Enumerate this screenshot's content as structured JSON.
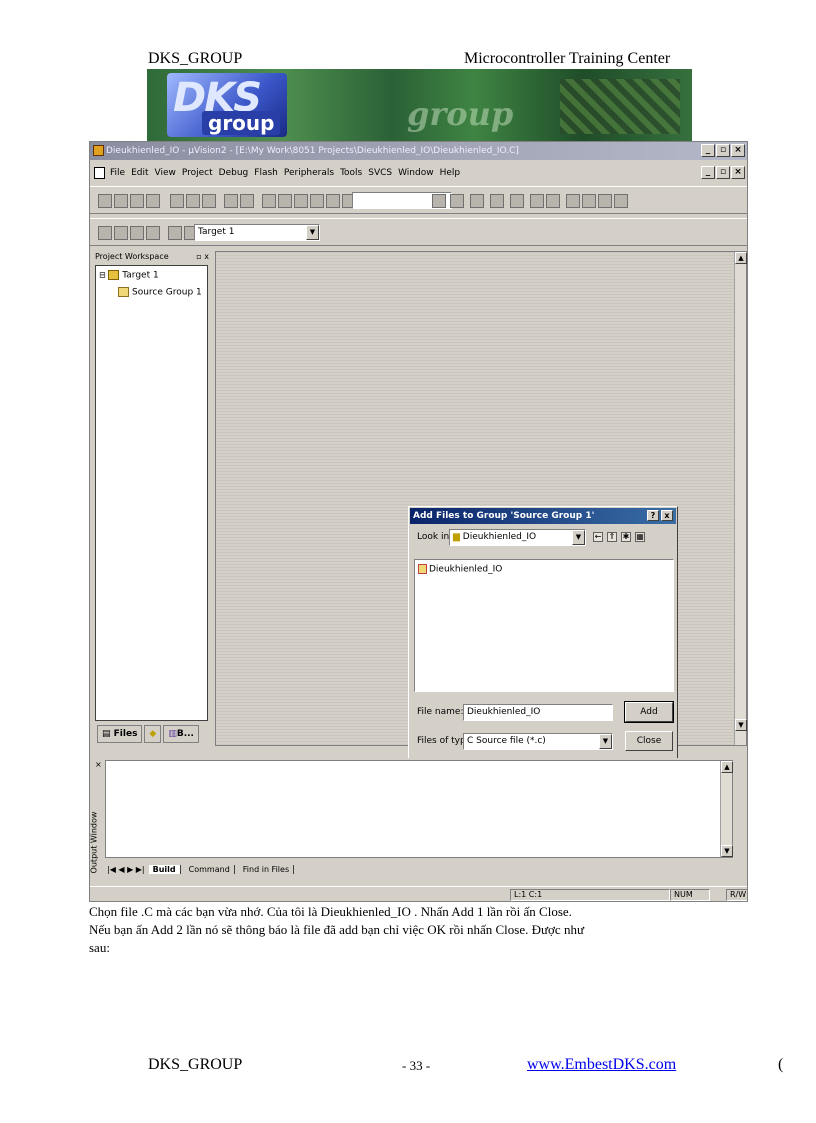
{
  "header": {
    "left": "DKS_GROUP",
    "right": "Microcontroller Training Center"
  },
  "banner": {
    "logo_text": "DKS",
    "logo_sub": "group",
    "watermark": "group"
  },
  "app": {
    "title": "Dieukhienled_IO - µVision2 - [E:\\My Work\\8051 Projects\\Dieukhienled_IO\\Dieukhienled_IO.C]",
    "menu": [
      "File",
      "Edit",
      "View",
      "Project",
      "Debug",
      "Flash",
      "Peripherals",
      "Tools",
      "SVCS",
      "Window",
      "Help"
    ],
    "target_combo": "Target 1",
    "workspace": {
      "title": "Project Workspace",
      "close": "▫ x",
      "tree": [
        "Target 1",
        "Source Group 1"
      ],
      "tabs": [
        "Files",
        "",
        "B..."
      ]
    },
    "dialog": {
      "title": "Add Files to Group 'Source Group 1'",
      "help_btn": "?",
      "close_btn": "x",
      "look_in_label": "Look in:",
      "look_in_value": "Dieukhienled_IO",
      "files": [
        "Dieukhienled_IO"
      ],
      "file_name_label": "File name:",
      "file_name_value": "Dieukhienled_IO",
      "files_of_type_label": "Files of type:",
      "files_of_type_value": "C Source file (*.c)",
      "add_btn": "Add",
      "close_btn_label": "Close"
    },
    "output": {
      "side_label": "Output Window",
      "tabs": [
        "Build",
        "Command",
        "Find in Files"
      ]
    },
    "status": {
      "pos": "L:1 C:1",
      "num": "NUM",
      "rw": "R/W"
    }
  },
  "body_text": {
    "line1": "Chọn file .C mà các bạn vừa nhớ. Của tôi là Dieukhienled_IO . Nhấn Add 1 lần rồi ấn Close.",
    "line2": "Nếu bạn ấn Add 2 lần nó sẽ thông báo là file đã add bạn chỉ việc OK rồi nhấn Close. Được như",
    "line3": "sau:"
  },
  "footer": {
    "left": "DKS_GROUP",
    "page": "- 33 -",
    "url": "www.EmbestDKS.com",
    "paren": "("
  }
}
